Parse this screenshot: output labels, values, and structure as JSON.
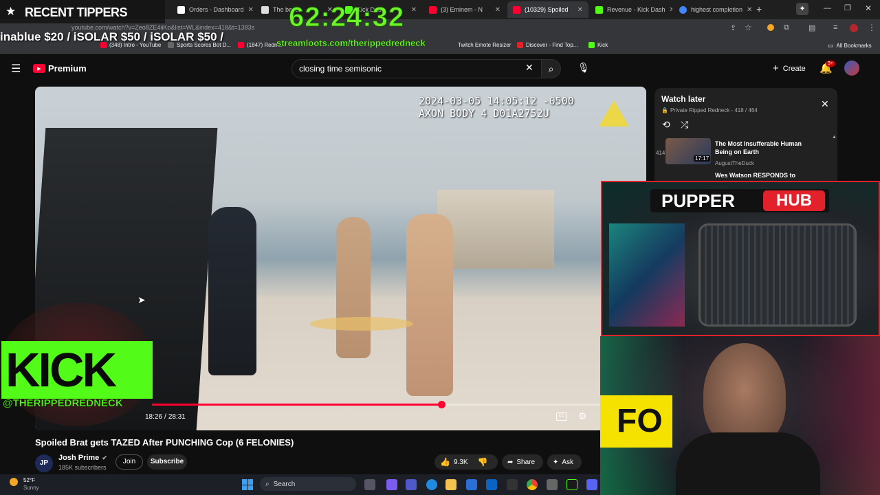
{
  "browser": {
    "tabs": [
      {
        "label": "Orders - Dashboard"
      },
      {
        "label": "The best..."
      },
      {
        "label": "Kick Dash"
      },
      {
        "label": "(3) Eminem - N"
      },
      {
        "label": "(10329) Spoiled"
      },
      {
        "label": "Revenue - Kick Dash"
      },
      {
        "label": "highest completion"
      }
    ],
    "url": "youtube.com/watch?v=Zeo8ZE4iiKo&list=WL&index=418&t=1383s",
    "bookmarks": [
      "(348) Intro - YouTube",
      "Sports Scores Bot D...",
      "(1847) Redn...",
      "Twitch Emote Resizer",
      "Discover - Find Top...",
      "Kick",
      "All Bookmarks"
    ]
  },
  "overlay": {
    "tippers_title": "RECENT TIPPERS",
    "tippers_ticker": "inablue $20 / iSOLAR $50 / iSOLAR $50 /",
    "timer": "62:24:32",
    "streamloots": "streamloots.com/therippedredneck",
    "kick_logo": "KICK",
    "kick_handle": "@THERIPPEDREDNECK",
    "pupper_hub_a": "PUPPER",
    "pupper_hub_b": "HUB",
    "cam_text": "FO"
  },
  "youtube": {
    "logo_text": "Premium",
    "search_value": "closing time semisonic",
    "create_label": "Create",
    "notif_count": "9+",
    "video": {
      "stamp_line1": "2024-03-05 14:05:12 -0500",
      "stamp_line2": "AXON BODY 4 D01A2752U",
      "time_current": "18:26",
      "time_sep": "/",
      "time_total": "28:31",
      "progress": 0.646,
      "title": "Spoiled Brat gets TAZED After PUNCHING Cop (6 FELONIES)"
    },
    "channel": {
      "name": "Josh Prime",
      "subscribers": "185K subscribers",
      "join_label": "Join",
      "subscribe_label": "Subscribe"
    },
    "actions": {
      "likes": "9.3K",
      "share_label": "Share",
      "ask_label": "Ask"
    },
    "watch_later": {
      "title": "Watch later",
      "subtitle": "Private Ripped Redneck - 418 / 464",
      "items": [
        {
          "index": "414",
          "title": "The Most Insufferable Human Being on Earth",
          "channel": "AugustTheDuck",
          "duration": "17:17"
        },
        {
          "index": "",
          "title": "Wes Watson RESPONDS to",
          "channel": "",
          "duration": ""
        }
      ]
    }
  },
  "taskbar": {
    "temp": "52°F",
    "weather": "Sunny",
    "search_label": "Search"
  },
  "colors": {
    "accent_red": "#ff0033",
    "kick_green": "#53fc18",
    "timer_green": "#6ef52a"
  }
}
